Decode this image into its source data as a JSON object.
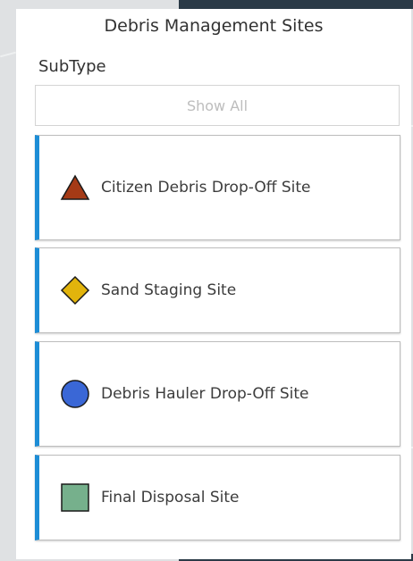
{
  "panel": {
    "title": "Debris Management Sites",
    "subtype_label": "SubType",
    "show_all_label": "Show All"
  },
  "items": [
    {
      "label": "Citizen Debris Drop-Off Site",
      "icon": "triangle-icon",
      "color": "#a53a16"
    },
    {
      "label": "Sand Staging Site",
      "icon": "diamond-icon",
      "color": "#e2b40c"
    },
    {
      "label": "Debris Hauler Drop-Off Site",
      "icon": "circle-icon",
      "color": "#3a67d6"
    },
    {
      "label": "Final Disposal Site",
      "icon": "square-icon",
      "color": "#76b08c"
    }
  ],
  "accent_color": "#1d8dd6"
}
